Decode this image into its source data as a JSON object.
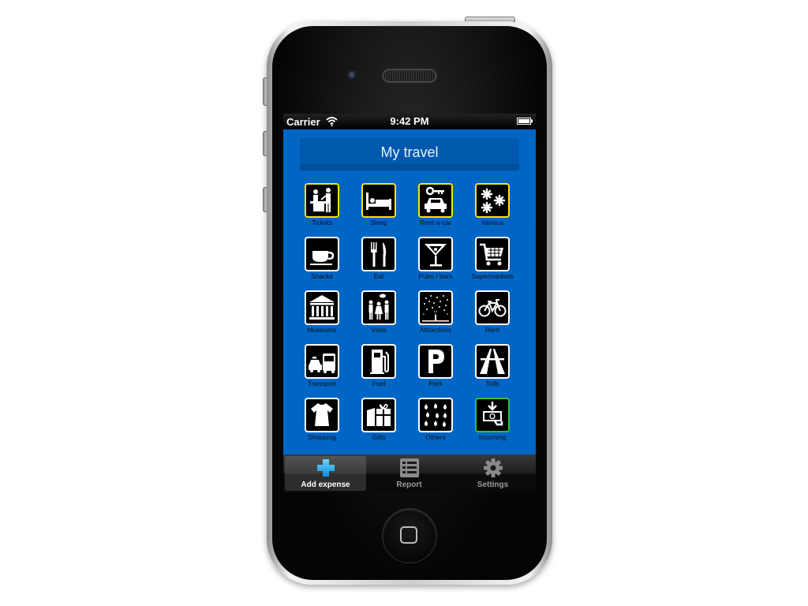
{
  "status_bar": {
    "carrier": "Carrier",
    "time": "9:42 PM"
  },
  "header": {
    "title": "My travel"
  },
  "categories": [
    {
      "label": "Tickets",
      "icon": "tickets-icon"
    },
    {
      "label": "Sleep",
      "icon": "bed-icon"
    },
    {
      "label": "Rent-a-car",
      "icon": "car-key-icon"
    },
    {
      "label": "Various",
      "icon": "asterisks-icon"
    },
    {
      "label": "Snacks",
      "icon": "coffee-cup-icon"
    },
    {
      "label": "Eat",
      "icon": "fork-knife-icon"
    },
    {
      "label": "Pubs / bars",
      "icon": "cocktail-glass-icon"
    },
    {
      "label": "Supermarkets",
      "icon": "shopping-cart-icon"
    },
    {
      "label": "Museums",
      "icon": "museum-icon"
    },
    {
      "label": "Visits",
      "icon": "tourists-icon"
    },
    {
      "label": "Attractions",
      "icon": "fireworks-icon"
    },
    {
      "label": "Rent",
      "icon": "bicycle-icon"
    },
    {
      "label": "Transport",
      "icon": "taxi-bus-icon"
    },
    {
      "label": "Fuel",
      "icon": "fuel-pump-icon"
    },
    {
      "label": "Park",
      "icon": "parking-icon"
    },
    {
      "label": "Tolls",
      "icon": "highway-icon"
    },
    {
      "label": "Shopping",
      "icon": "dress-icon"
    },
    {
      "label": "Gifts",
      "icon": "gift-icon"
    },
    {
      "label": "Others",
      "icon": "drops-icon"
    },
    {
      "label": "Incoming",
      "icon": "incoming-money-icon"
    }
  ],
  "tab_bar": {
    "items": [
      {
        "label": "Add expense",
        "icon": "plus-icon",
        "active": true
      },
      {
        "label": "Report",
        "icon": "report-list-icon",
        "active": false
      },
      {
        "label": "Settings",
        "icon": "gear-icon",
        "active": false
      }
    ]
  },
  "colors": {
    "app_background": "#0066c6",
    "title_bar": "#0059ad",
    "tile_border_white": "#ffffff",
    "tile_border_yellow": "#f4e600",
    "tile_border_green": "#2fc42f"
  }
}
